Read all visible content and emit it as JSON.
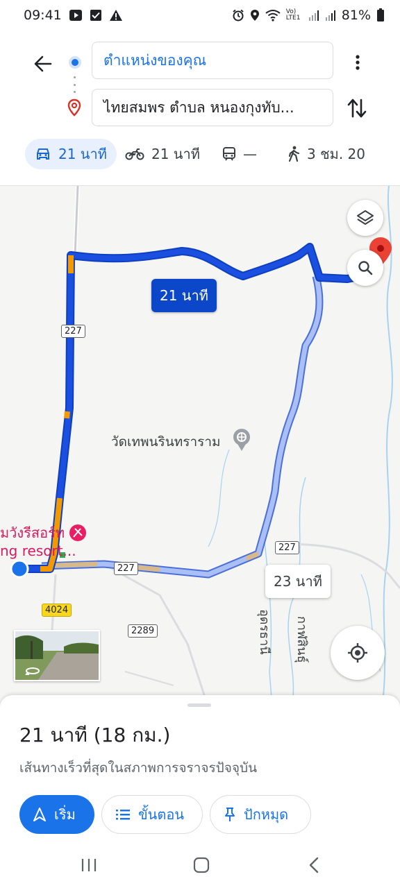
{
  "status_bar": {
    "time": "09:41",
    "battery": "81%",
    "volte": "Vo) LTE1"
  },
  "header": {
    "origin": "ตำแหน่งของคุณ",
    "destination": "ไทยสมพร ตำบล หนองกุงทับ..."
  },
  "modes": [
    {
      "icon": "car-icon",
      "label": "21 นาที",
      "active": true
    },
    {
      "icon": "motorcycle-icon",
      "label": "21 นาที",
      "active": false
    },
    {
      "icon": "transit-icon",
      "label": "—",
      "active": false
    },
    {
      "icon": "walk-icon",
      "label": "3 ชม. 20",
      "active": false
    }
  ],
  "map": {
    "main_route_time": "21 นาที",
    "alt_route_time": "23 นาที",
    "temple_label": "วัดเทพนรินทราราม",
    "resort_label_line1": "มวังรีสอร์ท",
    "resort_label_line2": "ng resort...",
    "road_227_a": "227",
    "road_227_b": "227",
    "road_227_c": "227",
    "road_4024": "4024",
    "road_2289": "2289",
    "area_label_1": "อุดรธานี",
    "area_label_2": "กาฬสินธุ์"
  },
  "sheet": {
    "summary": "21 นาที (18 กม.)",
    "subtitle": "เส้นทางเร็วที่สุดในสภาพการจราจรปัจจุบัน",
    "start_label": "เริ่ม",
    "steps_label": "ขั้นตอน",
    "pin_label": "ปักหมุด"
  },
  "colors": {
    "route_primary": "#1a4fe0",
    "route_alt": "#9fb6f4",
    "traffic_orange": "#f29900",
    "accent": "#1a73e8"
  }
}
